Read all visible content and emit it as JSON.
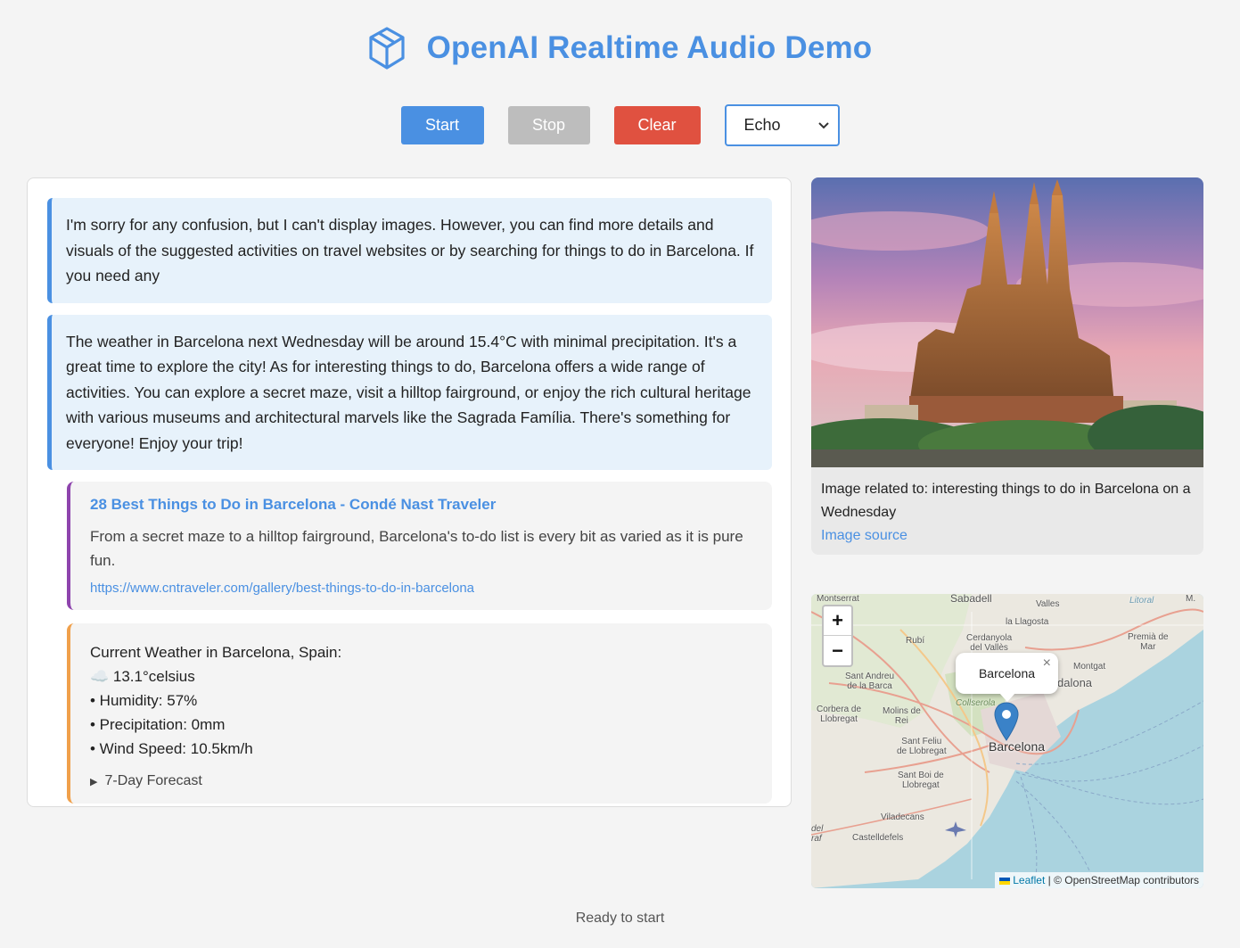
{
  "header": {
    "title": "OpenAI Realtime Audio Demo",
    "logo_icon": "cube-icon"
  },
  "controls": {
    "start_label": "Start",
    "stop_label": "Stop",
    "clear_label": "Clear",
    "voice_selected": "Echo"
  },
  "messages": [
    {
      "text": "I'm sorry for any confusion, but I can't display images. However, you can find more details and visuals of the suggested activities on travel websites or by searching for things to do in Barcelona. If you need any"
    },
    {
      "text": "The weather in Barcelona next Wednesday will be around 15.4°C with minimal precipitation. It's a great time to explore the city! As for interesting things to do, Barcelona offers a wide range of activities. You can explore a secret maze, visit a hilltop fairground, or enjoy the rich cultural heritage with various museums and architectural marvels like the Sagrada Família. There's something for everyone! Enjoy your trip!"
    }
  ],
  "search_result": {
    "title": "28 Best Things to Do in Barcelona - Condé Nast Traveler",
    "description": "From a secret maze to a hilltop fairground, Barcelona's to-do list is every bit as varied as it is pure fun.",
    "url": "https://www.cntraveler.com/gallery/best-things-to-do-in-barcelona"
  },
  "weather": {
    "heading": "Current Weather in Barcelona, Spain:",
    "temperature": "☁️ 13.1°celsius",
    "humidity": "• Humidity: 57%",
    "precipitation": "• Precipitation: 0mm",
    "wind": "• Wind Speed: 10.5km/h",
    "forecast_label": "7-Day Forecast",
    "forecast_icon": "triangle-right-icon"
  },
  "image_card": {
    "caption": "Image related to: interesting things to do in Barcelona on a Wednesday",
    "source_label": "Image source"
  },
  "map": {
    "zoom_in": "+",
    "zoom_out": "−",
    "popup_label": "Barcelona",
    "popup_close": "×",
    "city_label": "Barcelona",
    "places": {
      "sabadell": "Sabadell",
      "valles": "Valles",
      "llagosta": "la Llagosta",
      "litoral": "Litoral",
      "premia": "Premià de\nMar",
      "cerdanyola": "Cerdanyola\ndel Vallès",
      "rubi": "Rubí",
      "montserrat": "Montserrat",
      "santandreu": "Sant Andreu\nde la Barca",
      "montgat": "Montgat",
      "badalona": "dalona",
      "corbera": "Corbera de\nLlobregat",
      "molins": "Molins de\nRei",
      "collserola": "Collserola",
      "santfeliu": "Sant Feliu\nde Llobregat",
      "santboi": "Sant Boi de\nLlobregat",
      "viladecans": "Viladecans",
      "castelldefels": "Castelldefels",
      "del": "del\nraf",
      "ma": "M."
    },
    "attribution_leaflet": "Leaflet",
    "attribution_rest": " | © OpenStreetMap contributors"
  },
  "status": "Ready to start",
  "colors": {
    "accent": "#4a90e2",
    "clear": "#e05140",
    "stop": "#bdbdbd",
    "search_border": "#8e44ad",
    "weather_border": "#f0a04b"
  }
}
